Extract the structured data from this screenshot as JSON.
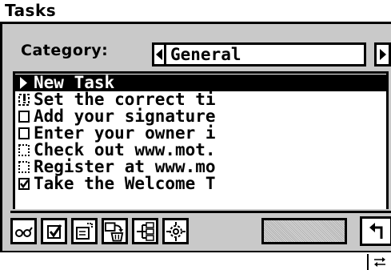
{
  "window": {
    "title": "Tasks"
  },
  "category": {
    "label": "Category:",
    "value": "General"
  },
  "tasks": [
    {
      "text": "New Task",
      "selected": true,
      "mark": "new-task-arrow-icon"
    },
    {
      "text": "Set the correct ti",
      "selected": false,
      "mark": "high-priority-checkbox-icon"
    },
    {
      "text": "Add your signature",
      "selected": false,
      "mark": "checkbox-icon"
    },
    {
      "text": "Enter your owner i",
      "selected": false,
      "mark": "checkbox-icon"
    },
    {
      "text": "Check out www.mot.",
      "selected": false,
      "mark": "low-priority-checkbox-icon"
    },
    {
      "text": "Register at www.mo",
      "selected": false,
      "mark": "low-priority-checkbox-icon"
    },
    {
      "text": "Take the Welcome T",
      "selected": false,
      "mark": "checked-checkbox-icon"
    }
  ],
  "toolbar": {
    "buttons": [
      "view-icon",
      "complete-task-icon",
      "edit-task-icon",
      "delete-task-icon",
      "tree-icon",
      "settings-icon"
    ],
    "back": "back-arrow-icon"
  },
  "input_area": {
    "icon": "keyboard-icon"
  },
  "colors": {
    "frame": "#c9c9c9",
    "selection": "#000000",
    "background": "#ffffff"
  }
}
